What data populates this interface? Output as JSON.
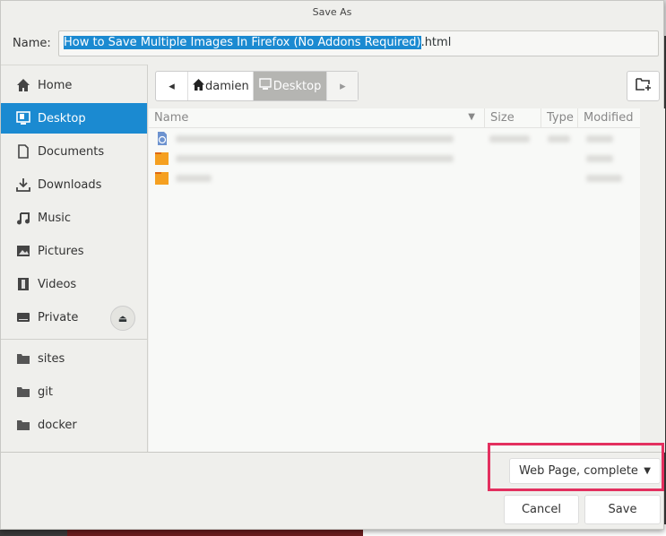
{
  "window": {
    "title": "Save As"
  },
  "name_field": {
    "label": "Name:",
    "selected_text": "How to Save Multiple Images In Firefox (No Addons Required)",
    "suffix": ".html"
  },
  "sidebar": {
    "items": [
      {
        "label": "Home",
        "icon": "home-icon"
      },
      {
        "label": "Desktop",
        "icon": "desktop-icon",
        "active": true
      },
      {
        "label": "Documents",
        "icon": "document-icon"
      },
      {
        "label": "Downloads",
        "icon": "download-icon"
      },
      {
        "label": "Music",
        "icon": "music-icon"
      },
      {
        "label": "Pictures",
        "icon": "picture-icon"
      },
      {
        "label": "Videos",
        "icon": "video-icon"
      },
      {
        "label": "Private",
        "icon": "drive-icon"
      },
      {
        "label": "sites",
        "icon": "folder-icon"
      },
      {
        "label": "git",
        "icon": "folder-icon"
      },
      {
        "label": "docker",
        "icon": "folder-icon"
      }
    ]
  },
  "pathbar": {
    "segments": [
      "damien",
      "Desktop"
    ],
    "current": "Desktop"
  },
  "file_list": {
    "columns": [
      "Name",
      "Size",
      "Type",
      "Modified"
    ],
    "rows": [
      {
        "icon": "html-file-icon"
      },
      {
        "icon": "folder-icon"
      },
      {
        "icon": "folder-icon"
      }
    ]
  },
  "filter": {
    "selected": "Web Page, complete"
  },
  "buttons": {
    "cancel": "Cancel",
    "save": "Save"
  },
  "colors": {
    "accent": "#1b8ad1",
    "highlight": "#e3305f",
    "folder": "#f5a020"
  }
}
